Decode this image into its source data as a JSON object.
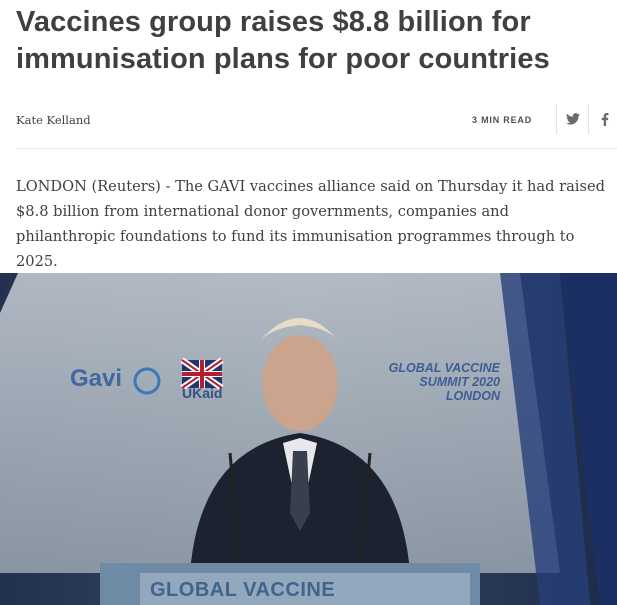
{
  "article": {
    "headline": "Vaccines group raises $8.8 billion for immunisation plans for poor countries",
    "author": "Kate Kelland",
    "read_time": "3 MIN READ",
    "lede": "LONDON (Reuters) - The GAVI vaccines alliance said on Thursday it had raised $8.8 billion from international donor governments, companies and philanthropic foundations to fund its immunisation programmes through to 2025."
  },
  "share": {
    "twitter_icon": "twitter-icon",
    "facebook_icon": "facebook-icon"
  },
  "photo": {
    "gavi_logo_text": "Gavi",
    "ukaid_text": "UKaid",
    "summit_line1": "GLOBAL VACCINE",
    "summit_line2": "SUMMIT 2020",
    "summit_line3": "LONDON",
    "podium_text": "GLOBAL VACCINE"
  },
  "colors": {
    "text": "#404040",
    "rule": "#e6e6e6",
    "summit_blue": "#2b4f8a"
  }
}
